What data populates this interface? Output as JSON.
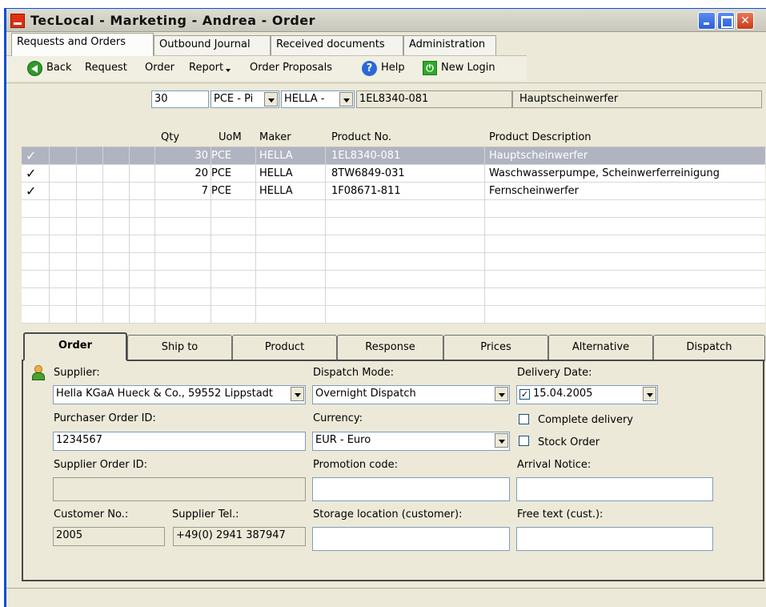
{
  "window": {
    "title": "TecLocal - Marketing - Andrea - Order"
  },
  "tabs": [
    {
      "label": "Requests and Orders"
    },
    {
      "label": "Outbound Journal"
    },
    {
      "label": "Received documents"
    },
    {
      "label": "Administration"
    }
  ],
  "toolbar": {
    "back": "Back",
    "request": "Request",
    "order": "Order",
    "report": "Report",
    "order_proposals": "Order Proposals",
    "help": "Help",
    "new_login": "New Login"
  },
  "entry": {
    "qty": "30",
    "uom": "PCE - Pi",
    "maker": "HELLA -",
    "product_no": "1EL8340-081",
    "description": "Hauptscheinwerfer"
  },
  "grid": {
    "headers": {
      "qty": "Qty",
      "uom": "UoM",
      "maker": "Maker",
      "product_no": "Product No.",
      "description": "Product Description"
    },
    "rows": [
      {
        "check": "✓",
        "qty": "30",
        "uom": "PCE",
        "maker": "HELLA",
        "product_no": "1EL8340-081",
        "description": "Hauptscheinwerfer"
      },
      {
        "check": "✓",
        "qty": "20",
        "uom": "PCE",
        "maker": "HELLA",
        "product_no": "8TW6849-031",
        "description": "Waschwasserpumpe, Scheinwerferreinigung"
      },
      {
        "check": "✓",
        "qty": "7",
        "uom": "PCE",
        "maker": "HELLA",
        "product_no": "1F08671-811",
        "description": "Fernscheinwerfer"
      }
    ]
  },
  "lower_tabs": [
    {
      "label": "Order"
    },
    {
      "label": "Ship to"
    },
    {
      "label": "Product"
    },
    {
      "label": "Response"
    },
    {
      "label": "Prices"
    },
    {
      "label": "Alternative"
    },
    {
      "label": "Dispatch"
    }
  ],
  "order": {
    "supplier_label": "Supplier:",
    "supplier_value": "Hella KGaA Hueck & Co., 59552 Lippstadt",
    "dispatch_mode_label": "Dispatch Mode:",
    "dispatch_mode_value": "Overnight Dispatch",
    "delivery_date_label": "Delivery Date:",
    "delivery_date_value": "15.04.2005",
    "purchaser_order_id_label": "Purchaser Order ID:",
    "purchaser_order_id_value": "1234567",
    "currency_label": "Currency:",
    "currency_value": "EUR - Euro",
    "complete_delivery_label": "Complete delivery",
    "stock_order_label": "Stock Order",
    "supplier_order_id_label": "Supplier Order ID:",
    "promotion_code_label": "Promotion code:",
    "arrival_notice_label": "Arrival Notice:",
    "customer_no_label": "Customer No.:",
    "customer_no_value": "2005",
    "supplier_tel_label": "Supplier Tel.:",
    "supplier_tel_value": "+49(0) 2941 387947",
    "storage_location_label": "Storage location (customer):",
    "free_text_label": "Free text (cust.):"
  }
}
